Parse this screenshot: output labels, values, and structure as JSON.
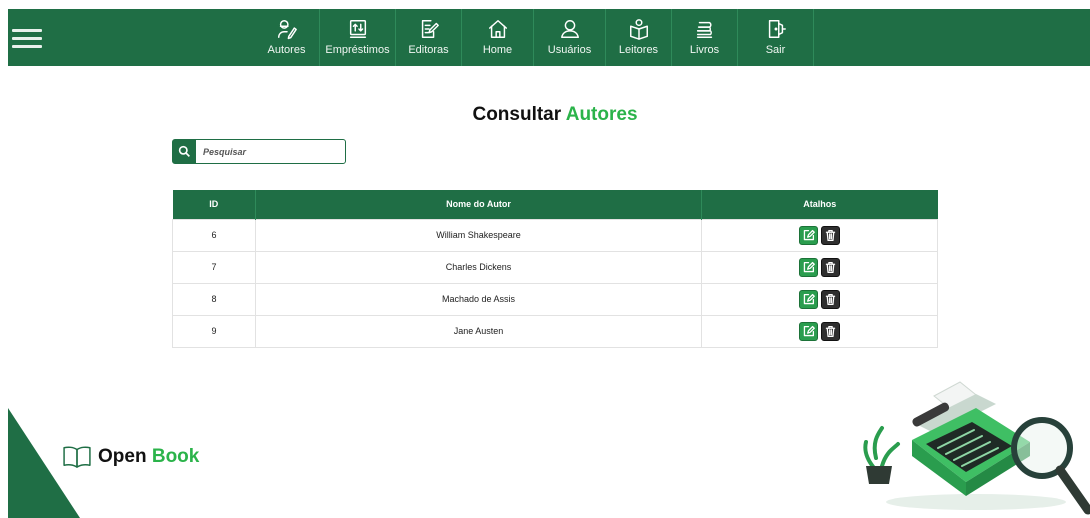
{
  "nav": {
    "items": [
      {
        "label": "Autores",
        "icon": "author-icon"
      },
      {
        "label": "Empréstimos",
        "icon": "loan-icon"
      },
      {
        "label": "Editoras",
        "icon": "publisher-icon"
      },
      {
        "label": "Home",
        "icon": "home-icon"
      },
      {
        "label": "Usuários",
        "icon": "user-icon"
      },
      {
        "label": "Leitores",
        "icon": "reader-icon"
      },
      {
        "label": "Livros",
        "icon": "books-icon"
      },
      {
        "label": "Sair",
        "icon": "logout-icon"
      }
    ]
  },
  "page": {
    "title_part1": "Consultar",
    "title_part2": "Autores"
  },
  "search": {
    "placeholder": "Pesquisar",
    "value": ""
  },
  "table": {
    "headers": [
      "ID",
      "Nome do Autor",
      "Atalhos"
    ],
    "rows": [
      {
        "id": "6",
        "name": "William Shakespeare"
      },
      {
        "id": "7",
        "name": "Charles Dickens"
      },
      {
        "id": "8",
        "name": "Machado de Assis"
      },
      {
        "id": "9",
        "name": "Jane Austen"
      }
    ]
  },
  "brand": {
    "part1": "Open",
    "part2": "Book"
  },
  "colors": {
    "primary": "#1f6e45",
    "accent": "#2bb34a",
    "edit": "#2a9d4e",
    "delete": "#2f2f2f"
  }
}
